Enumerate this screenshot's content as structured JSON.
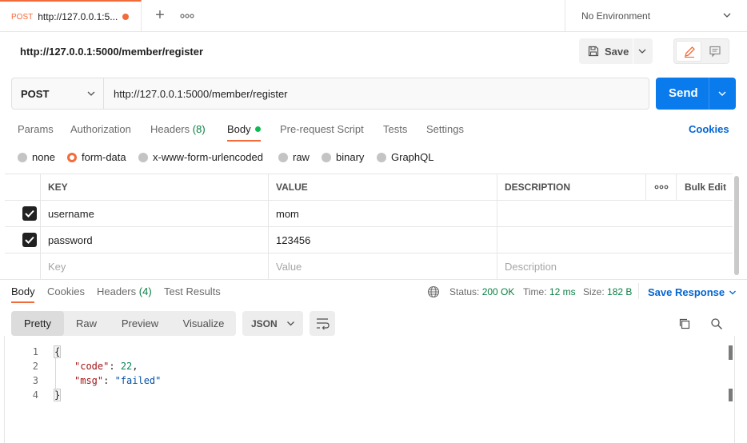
{
  "tab": {
    "method": "POST",
    "title": "http://127.0.0.1:5...",
    "plus": "+",
    "more": "ooo"
  },
  "environment": {
    "label": "No Environment"
  },
  "request": {
    "title": "http://127.0.0.1:5000/member/register",
    "save_label": "Save",
    "method": "POST",
    "url": "http://127.0.0.1:5000/member/register",
    "send_label": "Send"
  },
  "request_tabs": [
    {
      "label": "Params"
    },
    {
      "label": "Authorization"
    },
    {
      "label": "Headers",
      "count": "(8)"
    },
    {
      "label": "Body"
    },
    {
      "label": "Pre-request Script"
    },
    {
      "label": "Tests"
    },
    {
      "label": "Settings"
    }
  ],
  "cookies_label": "Cookies",
  "body_types": [
    {
      "label": "none",
      "selected": false
    },
    {
      "label": "form-data",
      "selected": true
    },
    {
      "label": "x-www-form-urlencoded",
      "selected": false
    },
    {
      "label": "raw",
      "selected": false
    },
    {
      "label": "binary",
      "selected": false
    },
    {
      "label": "GraphQL",
      "selected": false
    }
  ],
  "params_table": {
    "headers": {
      "key": "KEY",
      "value": "VALUE",
      "description": "DESCRIPTION",
      "more": "ooo",
      "bulk_edit": "Bulk Edit"
    },
    "rows": [
      {
        "checked": true,
        "key": "username",
        "value": "mom",
        "description": ""
      },
      {
        "checked": true,
        "key": "password",
        "value": "123456",
        "description": ""
      }
    ],
    "placeholder": {
      "key": "Key",
      "value": "Value",
      "description": "Description"
    }
  },
  "response": {
    "tabs": [
      {
        "label": "Body"
      },
      {
        "label": "Cookies"
      },
      {
        "label": "Headers",
        "count": "(4)"
      },
      {
        "label": "Test Results"
      }
    ],
    "status_label": "Status:",
    "status_value": "200 OK",
    "time_label": "Time:",
    "time_value": "12 ms",
    "size_label": "Size:",
    "size_value": "182 B",
    "save_response_label": "Save Response",
    "view_modes": [
      "Pretty",
      "Raw",
      "Preview",
      "Visualize"
    ],
    "active_view": "Pretty",
    "format": "JSON",
    "code_lines": {
      "l1_num": "1",
      "l2_num": "2",
      "l3_num": "3",
      "l4_num": "4",
      "open_brace": "{",
      "code_key": "\"code\"",
      "code_sep": ": ",
      "code_val": "22",
      "code_comma": ",",
      "msg_key": "\"msg\"",
      "msg_sep": ": ",
      "msg_val": "\"failed\"",
      "close_brace": "}"
    }
  },
  "colors": {
    "accent": "#f26b3a",
    "send": "#097bed",
    "link": "#0265d2",
    "status_ok": "#0a8043"
  }
}
